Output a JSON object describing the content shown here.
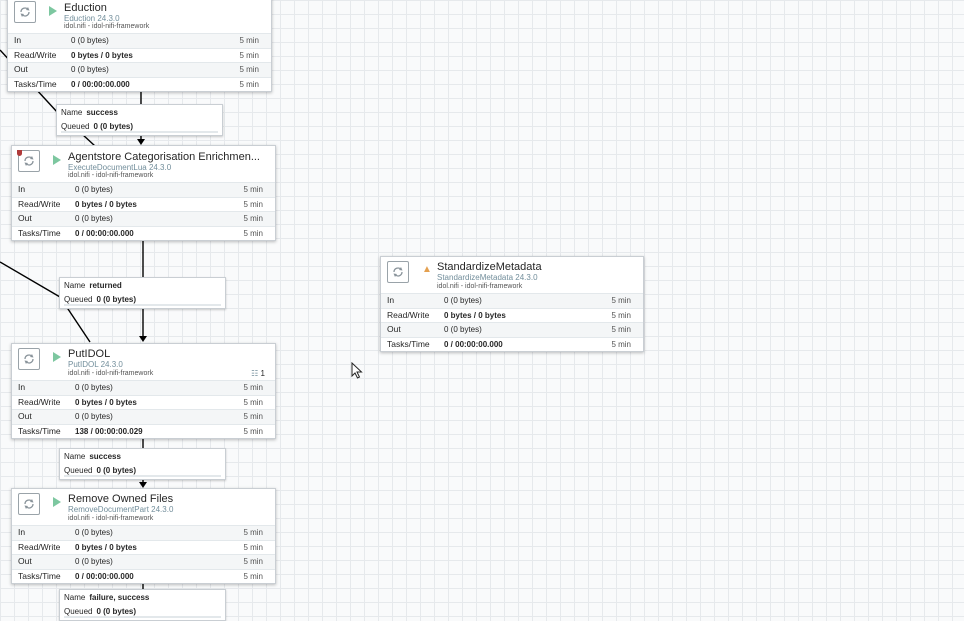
{
  "processors": [
    {
      "name": "Eduction",
      "type": "Eduction 24.3.0",
      "bundle": "idol.nifi - idol-nifi-framework",
      "status": "running",
      "stats": {
        "in_label": "In",
        "in_value": "0 (0 bytes)",
        "in_window": "5 min",
        "rw_label": "Read/Write",
        "rw_value": "0 bytes / 0 bytes",
        "rw_window": "5 min",
        "out_label": "Out",
        "out_value": "0 (0 bytes)",
        "out_window": "5 min",
        "tasks_label": "Tasks/Time",
        "tasks_value": "0 / 00:00:00.000",
        "tasks_window": "5 min"
      }
    },
    {
      "name": "Agentstore Categorisation Enrichmen...",
      "type": "ExecuteDocumentLua 24.3.0",
      "bundle": "idol.nifi - idol-nifi-framework",
      "status": "running",
      "stats": {
        "in_label": "In",
        "in_value": "0 (0 bytes)",
        "in_window": "5 min",
        "rw_label": "Read/Write",
        "rw_value": "0 bytes / 0 bytes",
        "rw_window": "5 min",
        "out_label": "Out",
        "out_value": "0 (0 bytes)",
        "out_window": "5 min",
        "tasks_label": "Tasks/Time",
        "tasks_value": "0 / 00:00:00.000",
        "tasks_window": "5 min"
      }
    },
    {
      "name": "PutIDOL",
      "type": "PutIDOL 24.3.0",
      "bundle": "idol.nifi - idol-nifi-framework",
      "status": "running",
      "active_threads": "1",
      "stats": {
        "in_label": "In",
        "in_value": "0 (0 bytes)",
        "in_window": "5 min",
        "rw_label": "Read/Write",
        "rw_value": "0 bytes / 0 bytes",
        "rw_window": "5 min",
        "out_label": "Out",
        "out_value": "0 (0 bytes)",
        "out_window": "5 min",
        "tasks_label": "Tasks/Time",
        "tasks_value": "138 / 00:00:00.029",
        "tasks_window": "5 min"
      }
    },
    {
      "name": "Remove Owned Files",
      "type": "RemoveDocumentPart 24.3.0",
      "bundle": "idol.nifi - idol-nifi-framework",
      "status": "running",
      "stats": {
        "in_label": "In",
        "in_value": "0 (0 bytes)",
        "in_window": "5 min",
        "rw_label": "Read/Write",
        "rw_value": "0 bytes / 0 bytes",
        "rw_window": "5 min",
        "out_label": "Out",
        "out_value": "0 (0 bytes)",
        "out_window": "5 min",
        "tasks_label": "Tasks/Time",
        "tasks_value": "0 / 00:00:00.000",
        "tasks_window": "5 min"
      }
    },
    {
      "name": "StandardizeMetadata",
      "type": "StandardizeMetadata 24.3.0",
      "bundle": "idol.nifi - idol-nifi-framework",
      "status": "invalid",
      "stats": {
        "in_label": "In",
        "in_value": "0 (0 bytes)",
        "in_window": "5 min",
        "rw_label": "Read/Write",
        "rw_value": "0 bytes / 0 bytes",
        "rw_window": "5 min",
        "out_label": "Out",
        "out_value": "0 (0 bytes)",
        "out_window": "5 min",
        "tasks_label": "Tasks/Time",
        "tasks_value": "0 / 00:00:00.000",
        "tasks_window": "5 min"
      }
    }
  ],
  "connections": [
    {
      "name_label": "Name",
      "name_value": "success",
      "queued_label": "Queued",
      "queued_value": "0 (0 bytes)"
    },
    {
      "name_label": "Name",
      "name_value": "returned",
      "queued_label": "Queued",
      "queued_value": "0 (0 bytes)"
    },
    {
      "name_label": "Name",
      "name_value": "success",
      "queued_label": "Queued",
      "queued_value": "0 (0 bytes)"
    },
    {
      "name_label": "Name",
      "name_value": "failure, success",
      "queued_label": "Queued",
      "queued_value": "0 (0 bytes)"
    }
  ],
  "colors": {
    "running": "#7dc7a0",
    "warning": "#e4a050",
    "type_text": "#728e9b",
    "canvas_grid": "#e6e9ec"
  },
  "icons": {
    "processor": "processor-icon",
    "play": "play-icon",
    "warning": "warning-icon",
    "threads": "active-threads-icon",
    "cursor": "mouse-cursor-icon"
  }
}
